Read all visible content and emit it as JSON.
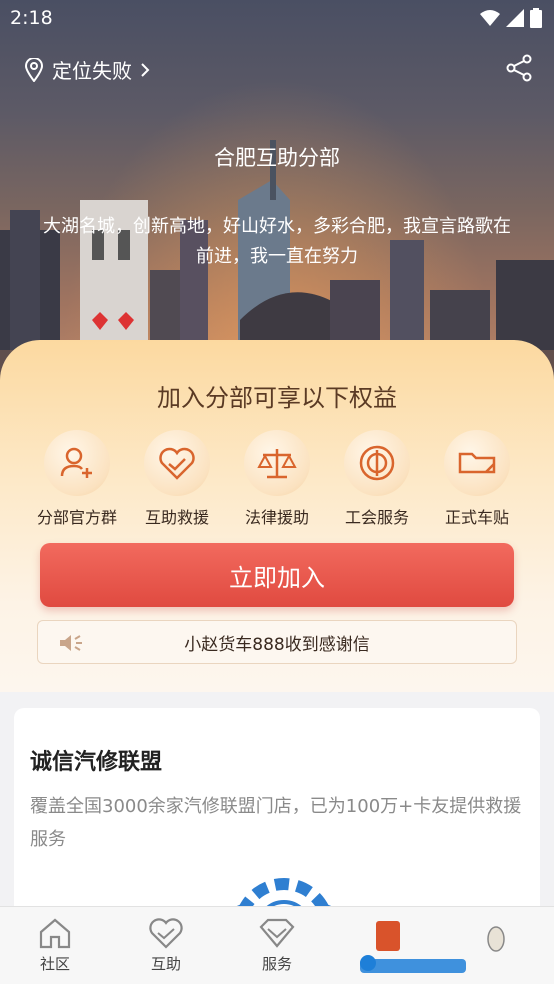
{
  "status_bar": {
    "time": "2:18"
  },
  "header": {
    "location": "定位失败"
  },
  "hero": {
    "title": "合肥互助分部",
    "description": "大湖名城，创新高地，好山好水，多彩合肥，我宣言路歌在前进，我一直在努力"
  },
  "benefits": {
    "title": "加入分部可享以下权益",
    "items": [
      {
        "label": "分部官方群",
        "icon": "group-add-icon"
      },
      {
        "label": "互助救援",
        "icon": "heart-handshake-icon"
      },
      {
        "label": "法律援助",
        "icon": "scale-icon"
      },
      {
        "label": "工会服务",
        "icon": "union-badge-icon"
      },
      {
        "label": "正式车贴",
        "icon": "car-sticker-icon"
      }
    ],
    "join_label": "立即加入",
    "notice": "小赵货车888收到感谢信"
  },
  "card": {
    "title": "诚信汽修联盟",
    "description": "覆盖全国3000余家汽修联盟门店，已为100万+卡友提供救援服务"
  },
  "bottom_nav": {
    "items": [
      {
        "label": "社区",
        "icon": "home-icon"
      },
      {
        "label": "互助",
        "icon": "heart-icon"
      },
      {
        "label": "服务",
        "icon": "diamond-icon"
      }
    ]
  },
  "colors": {
    "accent_red": "#e04a40",
    "benefit_brown": "#5a3a24",
    "icon_orange": "#d9652d"
  }
}
